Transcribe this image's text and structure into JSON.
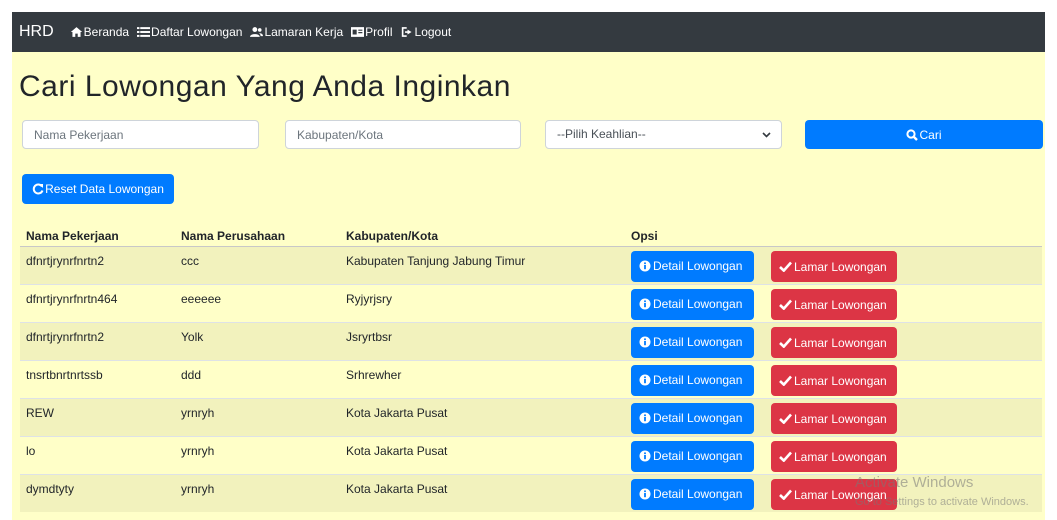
{
  "navbar": {
    "brand": "HRD",
    "links": [
      {
        "label": "Beranda",
        "icon": "home-icon"
      },
      {
        "label": "Daftar Lowongan",
        "icon": "list-icon"
      },
      {
        "label": "Lamaran Kerja",
        "icon": "users-icon"
      },
      {
        "label": "Profil",
        "icon": "id-card-icon"
      },
      {
        "label": "Logout",
        "icon": "logout-icon"
      }
    ]
  },
  "page": {
    "title": "Cari Lowongan Yang Anda Inginkan"
  },
  "search": {
    "job_placeholder": "Nama Pekerjaan",
    "city_placeholder": "Kabupaten/Kota",
    "skill_selected": "--Pilih Keahlian--",
    "search_label": "Cari",
    "reset_label": "Reset Data Lowongan"
  },
  "table": {
    "headers": [
      "Nama Pekerjaan",
      "Nama Perusahaan",
      "Kabupaten/Kota",
      "Opsi"
    ],
    "detail_label": "Detail Lowongan",
    "apply_label": "Lamar Lowongan",
    "rows": [
      {
        "job": "dfnrtjrynrfnrtn2",
        "company": "ccc",
        "city": "Kabupaten Tanjung Jabung Timur"
      },
      {
        "job": "dfnrtjrynrfnrtn464",
        "company": "eeeeee",
        "city": "Ryjyrjsry"
      },
      {
        "job": "dfnrtjrynrfnrtn2",
        "company": "Yolk",
        "city": "Jsryrtbsr"
      },
      {
        "job": "tnsrtbnrtnrtssb",
        "company": "ddd",
        "city": "Srhrewher"
      },
      {
        "job": "REW",
        "company": "yrnryh",
        "city": "Kota Jakarta Pusat"
      },
      {
        "job": "lo",
        "company": "yrnryh",
        "city": "Kota Jakarta Pusat"
      },
      {
        "job": "dymdtyty",
        "company": "yrnryh",
        "city": "Kota Jakarta Pusat"
      }
    ]
  },
  "watermark": {
    "line1": "Activate Windows",
    "line2": "Go to Settings to activate Windows."
  },
  "colors": {
    "navbar": "#343a40",
    "page_bg": "#ffffc8",
    "primary": "#007bff",
    "danger": "#dc3545"
  }
}
